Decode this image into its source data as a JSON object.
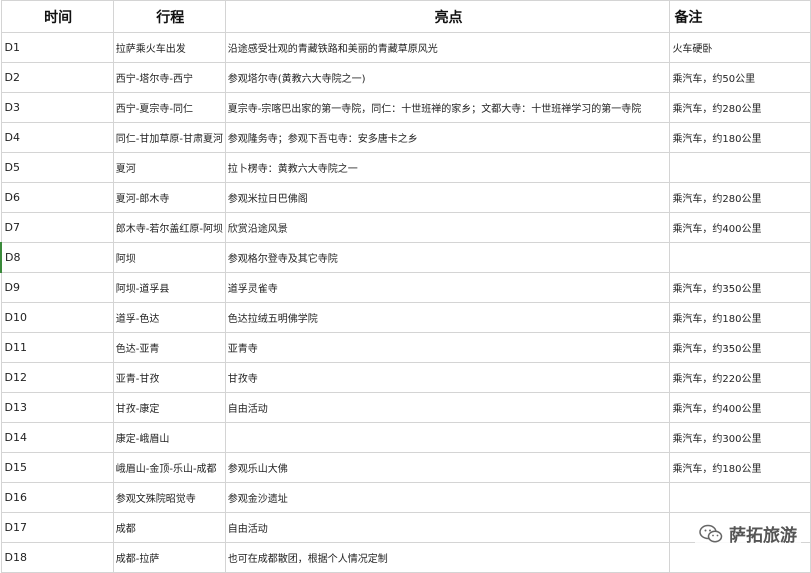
{
  "table": {
    "headers": {
      "time": "时间",
      "route": "行程",
      "highlights": "亮点",
      "notes": "备注"
    },
    "rows": [
      {
        "day": "D1",
        "route": "拉萨乘火车出发",
        "highlight": "沿途感受壮观的青藏铁路和美丽的青藏草原风光",
        "note": "火车硬卧"
      },
      {
        "day": "D2",
        "route": "西宁-塔尔寺-西宁",
        "highlight": "参观塔尔寺(黄教六大寺院之一)",
        "note": "乘汽车，约50公里"
      },
      {
        "day": "D3",
        "route": "西宁-夏宗寺-同仁",
        "highlight": "夏宗寺-宗喀巴出家的第一寺院，同仁：十世班禅的家乡；文都大寺：十世班禅学习的第一寺院",
        "note": "乘汽车，约280公里"
      },
      {
        "day": "D4",
        "route": "同仁-甘加草原-甘肃夏河",
        "highlight": "参观隆务寺；参观下吾屯寺：安多唐卡之乡",
        "note": "乘汽车，约180公里"
      },
      {
        "day": "D5",
        "route": "夏河",
        "highlight": "拉卜楞寺：黄教六大寺院之一",
        "note": ""
      },
      {
        "day": "D6",
        "route": "夏河-郎木寺",
        "highlight": "参观米拉日巴佛阁",
        "note": "乘汽车，约280公里"
      },
      {
        "day": "D7",
        "route": "郎木寺-若尔盖红原-阿坝",
        "highlight": "欣赏沿途风景",
        "note": "乘汽车，约400公里"
      },
      {
        "day": "D8",
        "route": "阿坝",
        "highlight": "参观格尔登寺及其它寺院",
        "note": ""
      },
      {
        "day": "D9",
        "route": "阿坝-道孚县",
        "highlight": "道孚灵雀寺",
        "note": "乘汽车，约350公里"
      },
      {
        "day": "D10",
        "route": "道孚-色达",
        "highlight": "色达拉绒五明佛学院",
        "note": "乘汽车，约180公里"
      },
      {
        "day": "D11",
        "route": "色达-亚青",
        "highlight": "亚青寺",
        "note": "乘汽车，约350公里"
      },
      {
        "day": "D12",
        "route": "亚青-甘孜",
        "highlight": "甘孜寺",
        "note": "乘汽车，约220公里"
      },
      {
        "day": "D13",
        "route": "甘孜-康定",
        "highlight": "自由活动",
        "note": "乘汽车，约400公里"
      },
      {
        "day": "D14",
        "route": "康定-峨眉山",
        "highlight": "",
        "note": "乘汽车，约300公里"
      },
      {
        "day": "D15",
        "route": "峨眉山-金顶-乐山-成都",
        "highlight": "参观乐山大佛",
        "note": "乘汽车，约180公里"
      },
      {
        "day": "D16",
        "route": "参观文殊院昭觉寺",
        "highlight": "参观金沙遗址",
        "note": ""
      },
      {
        "day": "D17",
        "route": "成都",
        "highlight": "自由活动",
        "note": ""
      },
      {
        "day": "D18",
        "route": "成都-拉萨",
        "highlight": "也可在成都散团，根据个人情况定制",
        "note": ""
      }
    ]
  },
  "watermark": {
    "text": "萨拓旅游",
    "icon": "wechat-icon"
  }
}
